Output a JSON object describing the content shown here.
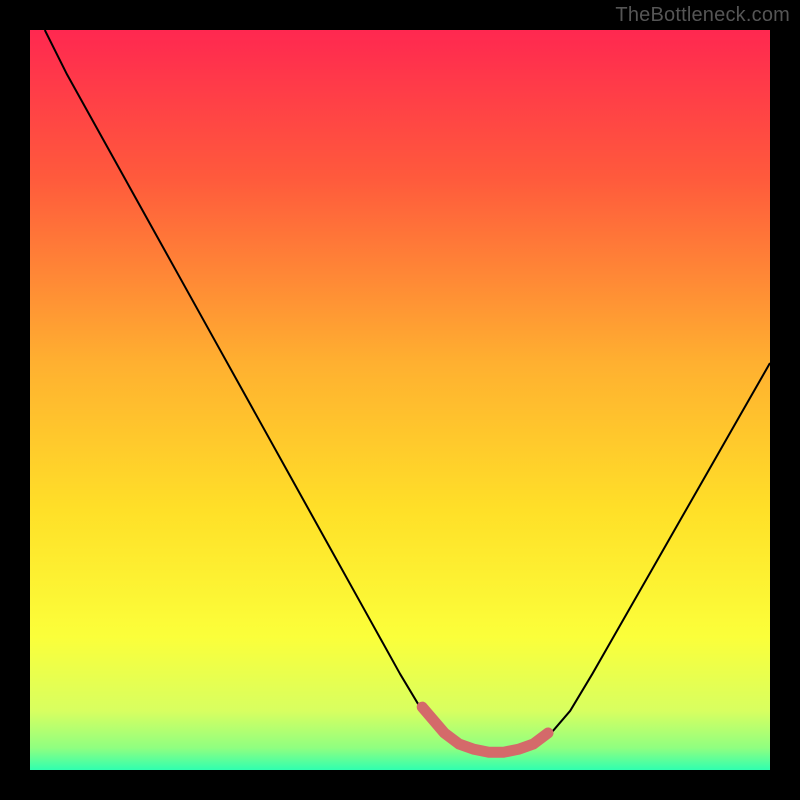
{
  "watermark": "TheBottleneck.com",
  "chart_data": {
    "type": "line",
    "title": "",
    "xlabel": "",
    "ylabel": "",
    "xlim": [
      0,
      100
    ],
    "ylim": [
      0,
      100
    ],
    "grid": false,
    "legend": false,
    "gradient_stops": [
      {
        "offset": 0.0,
        "color": "#ff2850"
      },
      {
        "offset": 0.2,
        "color": "#ff5a3c"
      },
      {
        "offset": 0.45,
        "color": "#ffb030"
      },
      {
        "offset": 0.65,
        "color": "#ffe028"
      },
      {
        "offset": 0.82,
        "color": "#fbff3a"
      },
      {
        "offset": 0.92,
        "color": "#d8ff60"
      },
      {
        "offset": 0.97,
        "color": "#90ff80"
      },
      {
        "offset": 1.0,
        "color": "#30ffb0"
      }
    ],
    "series": [
      {
        "name": "bottleneck-curve",
        "color": "#000000",
        "stroke_width": 2,
        "x": [
          2,
          5,
          10,
          15,
          20,
          25,
          30,
          35,
          40,
          45,
          50,
          53,
          56,
          58,
          60,
          62,
          64,
          66,
          68,
          70,
          73,
          76,
          80,
          84,
          88,
          92,
          96,
          100
        ],
        "y": [
          100,
          94,
          85,
          76,
          67,
          58,
          49,
          40,
          31,
          22,
          13,
          8,
          4.5,
          3.2,
          2.5,
          2.2,
          2.2,
          2.5,
          3.2,
          4.5,
          8,
          13,
          20,
          27,
          34,
          41,
          48,
          55
        ]
      },
      {
        "name": "optimal-range-highlight",
        "color": "#d46a6a",
        "stroke_width": 11,
        "linecap": "round",
        "x": [
          53,
          56,
          58,
          60,
          62,
          64,
          66,
          68,
          70
        ],
        "y": [
          8.5,
          5,
          3.5,
          2.8,
          2.4,
          2.4,
          2.8,
          3.5,
          5
        ]
      }
    ]
  }
}
